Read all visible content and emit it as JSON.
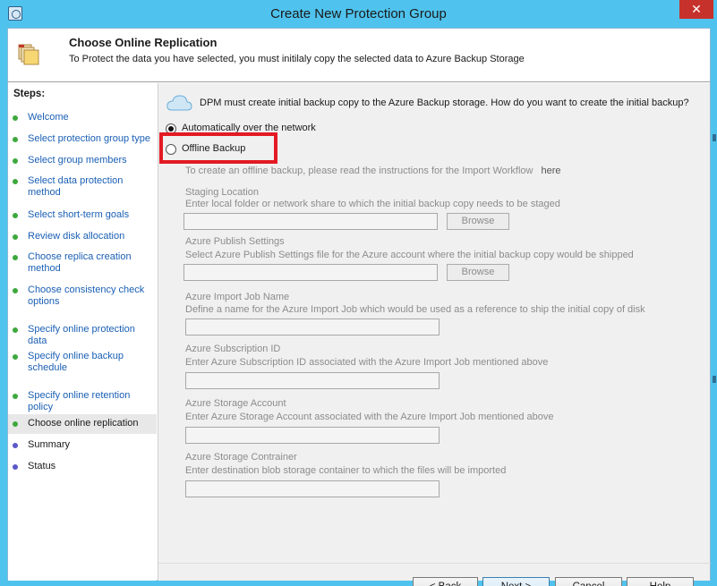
{
  "window": {
    "title": "Create New Protection Group",
    "close_glyph": "✕"
  },
  "header": {
    "title": "Choose Online Replication",
    "subtitle": "To Protect the data you have selected, you must initilaly copy the selected data to Azure Backup Storage",
    "icon": "folder-icon"
  },
  "sidebar": {
    "steps_label": "Steps:",
    "items": [
      {
        "label": "Welcome",
        "state": "done"
      },
      {
        "label": "Select protection group type",
        "state": "done"
      },
      {
        "label": "Select group members",
        "state": "done"
      },
      {
        "label": "Select data protection method",
        "state": "done"
      },
      {
        "label": "Select short-term goals",
        "state": "done"
      },
      {
        "label": "Review disk allocation",
        "state": "done"
      },
      {
        "label": "Choose replica creation method",
        "state": "done"
      },
      {
        "label": "Choose consistency check options",
        "state": "done"
      },
      {
        "label": "Specify online protection data",
        "state": "done"
      },
      {
        "label": "Specify online backup schedule",
        "state": "done"
      },
      {
        "label": "Specify online retention policy",
        "state": "done"
      },
      {
        "label": "Choose online replication",
        "state": "current"
      },
      {
        "label": "Summary",
        "state": "pending"
      },
      {
        "label": "Status",
        "state": "pending"
      }
    ]
  },
  "main": {
    "question": "DPM must create initial backup copy to the Azure Backup storage. How do you want to create the initial backup?",
    "radio_network": "Automatically over the network",
    "radio_offline": "Offline Backup",
    "selected_option": "Automatically over the network",
    "offline_instructions": "To create an offline backup, please read the instructions for the Import Workflow",
    "offline_link": "here",
    "staging": {
      "label": "Staging Location",
      "description": "Enter local folder or network share to which the initial backup copy needs to be staged",
      "value": "",
      "browse": "Browse"
    },
    "publish": {
      "label": "Azure Publish Settings",
      "description": "Select Azure Publish Settings file for the Azure account where the initial backup copy would be shipped",
      "value": "",
      "browse": "Browse"
    },
    "import_job": {
      "label": "Azure Import Job Name",
      "description": "Define a name for the Azure Import Job which would be used as a reference to ship the initial copy of disk",
      "value": ""
    },
    "subscription": {
      "label": "Azure Subscription ID",
      "description": "Enter Azure Subscription ID associated with the Azure Import Job mentioned above",
      "value": ""
    },
    "storage_account": {
      "label": "Azure Storage Account",
      "description": "Enter Azure Storage Account associated with the Azure Import Job mentioned above",
      "value": ""
    },
    "storage_container": {
      "label": "Azure Storage Contrainer",
      "description": "Enter destination blob storage container to which the files will be imported",
      "value": ""
    }
  },
  "footer": {
    "back": "< Back",
    "next": "Next >",
    "cancel": "Cancel",
    "help": "Help"
  },
  "colors": {
    "titlebar": "#4fc3ee",
    "close": "#c7312b",
    "highlight": "#e31a24",
    "link": "#1a5fb4"
  }
}
